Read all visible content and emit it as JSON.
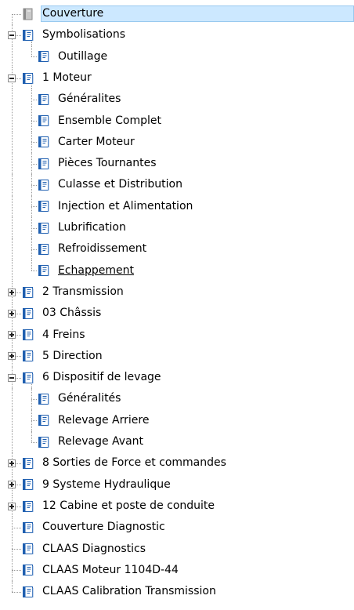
{
  "tree": {
    "rows": [
      {
        "label": "Couverture",
        "depth": 0,
        "toggle": "none",
        "icon": "closed-book-icon",
        "selected": true,
        "hot": false,
        "last_in_parent": false
      },
      {
        "label": "Symbolisations",
        "depth": 0,
        "toggle": "collapse",
        "icon": "book-icon",
        "selected": false,
        "hot": false,
        "last_in_parent": false
      },
      {
        "label": "Outillage",
        "depth": 1,
        "toggle": "none",
        "icon": "book-icon",
        "selected": false,
        "hot": false,
        "last_in_parent": true
      },
      {
        "label": "1 Moteur",
        "depth": 0,
        "toggle": "collapse",
        "icon": "book-icon",
        "selected": false,
        "hot": false,
        "last_in_parent": false
      },
      {
        "label": "Généralites",
        "depth": 1,
        "toggle": "none",
        "icon": "book-icon",
        "selected": false,
        "hot": false,
        "last_in_parent": false
      },
      {
        "label": "Ensemble Complet",
        "depth": 1,
        "toggle": "none",
        "icon": "book-icon",
        "selected": false,
        "hot": false,
        "last_in_parent": false
      },
      {
        "label": "Carter Moteur",
        "depth": 1,
        "toggle": "none",
        "icon": "book-icon",
        "selected": false,
        "hot": false,
        "last_in_parent": false
      },
      {
        "label": "Pièces Tournantes",
        "depth": 1,
        "toggle": "none",
        "icon": "book-icon",
        "selected": false,
        "hot": false,
        "last_in_parent": false
      },
      {
        "label": "Culasse et Distribution",
        "depth": 1,
        "toggle": "none",
        "icon": "book-icon",
        "selected": false,
        "hot": false,
        "last_in_parent": false
      },
      {
        "label": "Injection et Alimentation",
        "depth": 1,
        "toggle": "none",
        "icon": "book-icon",
        "selected": false,
        "hot": false,
        "last_in_parent": false
      },
      {
        "label": "Lubrification",
        "depth": 1,
        "toggle": "none",
        "icon": "book-icon",
        "selected": false,
        "hot": false,
        "last_in_parent": false
      },
      {
        "label": "Refroidissement",
        "depth": 1,
        "toggle": "none",
        "icon": "book-icon",
        "selected": false,
        "hot": false,
        "last_in_parent": false
      },
      {
        "label": "Echappement",
        "depth": 1,
        "toggle": "none",
        "icon": "book-icon",
        "selected": false,
        "hot": true,
        "last_in_parent": true
      },
      {
        "label": "2 Transmission",
        "depth": 0,
        "toggle": "expand",
        "icon": "book-icon",
        "selected": false,
        "hot": false,
        "last_in_parent": false
      },
      {
        "label": "03 Châssis",
        "depth": 0,
        "toggle": "expand",
        "icon": "book-icon",
        "selected": false,
        "hot": false,
        "last_in_parent": false
      },
      {
        "label": "4 Freins",
        "depth": 0,
        "toggle": "expand",
        "icon": "book-icon",
        "selected": false,
        "hot": false,
        "last_in_parent": false
      },
      {
        "label": "5 Direction",
        "depth": 0,
        "toggle": "expand",
        "icon": "book-icon",
        "selected": false,
        "hot": false,
        "last_in_parent": false
      },
      {
        "label": "6 Dispositif de levage",
        "depth": 0,
        "toggle": "collapse",
        "icon": "book-icon",
        "selected": false,
        "hot": false,
        "last_in_parent": false
      },
      {
        "label": "Généralités",
        "depth": 1,
        "toggle": "none",
        "icon": "book-icon",
        "selected": false,
        "hot": false,
        "last_in_parent": false
      },
      {
        "label": "Relevage Arriere",
        "depth": 1,
        "toggle": "none",
        "icon": "book-icon",
        "selected": false,
        "hot": false,
        "last_in_parent": false
      },
      {
        "label": "Relevage Avant",
        "depth": 1,
        "toggle": "none",
        "icon": "book-icon",
        "selected": false,
        "hot": false,
        "last_in_parent": true
      },
      {
        "label": "8 Sorties de Force et commandes",
        "depth": 0,
        "toggle": "expand",
        "icon": "book-icon",
        "selected": false,
        "hot": false,
        "last_in_parent": false
      },
      {
        "label": "9 Systeme Hydraulique",
        "depth": 0,
        "toggle": "expand",
        "icon": "book-icon",
        "selected": false,
        "hot": false,
        "last_in_parent": false
      },
      {
        "label": "12 Cabine et poste de conduite",
        "depth": 0,
        "toggle": "expand",
        "icon": "book-icon",
        "selected": false,
        "hot": false,
        "last_in_parent": false
      },
      {
        "label": "Couverture Diagnostic",
        "depth": 0,
        "toggle": "none",
        "icon": "book-icon",
        "selected": false,
        "hot": false,
        "last_in_parent": false
      },
      {
        "label": "CLAAS Diagnostics",
        "depth": 0,
        "toggle": "none",
        "icon": "book-icon",
        "selected": false,
        "hot": false,
        "last_in_parent": false
      },
      {
        "label": "CLAAS Moteur 1104D-44",
        "depth": 0,
        "toggle": "none",
        "icon": "book-icon",
        "selected": false,
        "hot": false,
        "last_in_parent": false
      },
      {
        "label": "CLAAS Calibration Transmission",
        "depth": 0,
        "toggle": "none",
        "icon": "book-icon",
        "selected": false,
        "hot": false,
        "last_in_parent": true
      }
    ]
  },
  "colors": {
    "selection_bg": "#cce8ff",
    "selection_border": "#99c9ef",
    "book_blue": "#1f5fb0",
    "book_grey": "#8a8a8a"
  }
}
